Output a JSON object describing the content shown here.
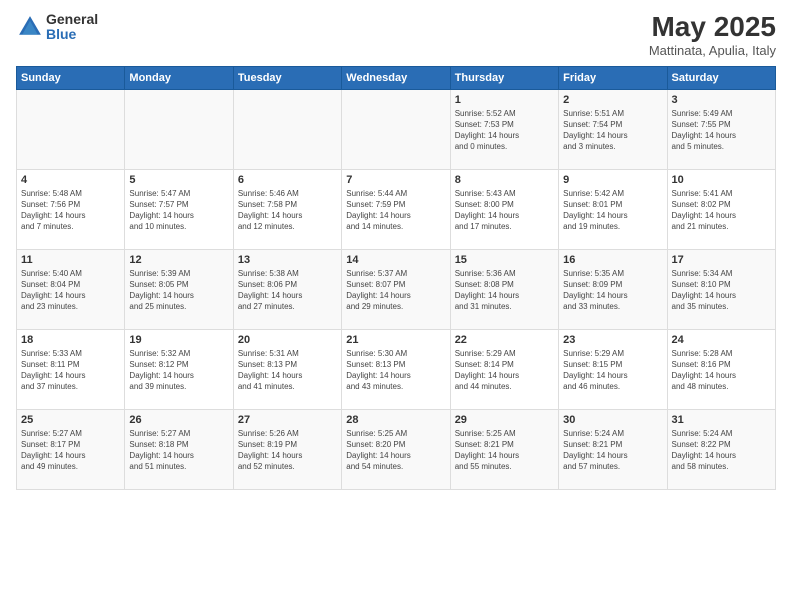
{
  "header": {
    "logo_general": "General",
    "logo_blue": "Blue",
    "month_title": "May 2025",
    "subtitle": "Mattinata, Apulia, Italy"
  },
  "days_of_week": [
    "Sunday",
    "Monday",
    "Tuesday",
    "Wednesday",
    "Thursday",
    "Friday",
    "Saturday"
  ],
  "weeks": [
    [
      {
        "day": "",
        "info": ""
      },
      {
        "day": "",
        "info": ""
      },
      {
        "day": "",
        "info": ""
      },
      {
        "day": "",
        "info": ""
      },
      {
        "day": "1",
        "info": "Sunrise: 5:52 AM\nSunset: 7:53 PM\nDaylight: 14 hours\nand 0 minutes."
      },
      {
        "day": "2",
        "info": "Sunrise: 5:51 AM\nSunset: 7:54 PM\nDaylight: 14 hours\nand 3 minutes."
      },
      {
        "day": "3",
        "info": "Sunrise: 5:49 AM\nSunset: 7:55 PM\nDaylight: 14 hours\nand 5 minutes."
      }
    ],
    [
      {
        "day": "4",
        "info": "Sunrise: 5:48 AM\nSunset: 7:56 PM\nDaylight: 14 hours\nand 7 minutes."
      },
      {
        "day": "5",
        "info": "Sunrise: 5:47 AM\nSunset: 7:57 PM\nDaylight: 14 hours\nand 10 minutes."
      },
      {
        "day": "6",
        "info": "Sunrise: 5:46 AM\nSunset: 7:58 PM\nDaylight: 14 hours\nand 12 minutes."
      },
      {
        "day": "7",
        "info": "Sunrise: 5:44 AM\nSunset: 7:59 PM\nDaylight: 14 hours\nand 14 minutes."
      },
      {
        "day": "8",
        "info": "Sunrise: 5:43 AM\nSunset: 8:00 PM\nDaylight: 14 hours\nand 17 minutes."
      },
      {
        "day": "9",
        "info": "Sunrise: 5:42 AM\nSunset: 8:01 PM\nDaylight: 14 hours\nand 19 minutes."
      },
      {
        "day": "10",
        "info": "Sunrise: 5:41 AM\nSunset: 8:02 PM\nDaylight: 14 hours\nand 21 minutes."
      }
    ],
    [
      {
        "day": "11",
        "info": "Sunrise: 5:40 AM\nSunset: 8:04 PM\nDaylight: 14 hours\nand 23 minutes."
      },
      {
        "day": "12",
        "info": "Sunrise: 5:39 AM\nSunset: 8:05 PM\nDaylight: 14 hours\nand 25 minutes."
      },
      {
        "day": "13",
        "info": "Sunrise: 5:38 AM\nSunset: 8:06 PM\nDaylight: 14 hours\nand 27 minutes."
      },
      {
        "day": "14",
        "info": "Sunrise: 5:37 AM\nSunset: 8:07 PM\nDaylight: 14 hours\nand 29 minutes."
      },
      {
        "day": "15",
        "info": "Sunrise: 5:36 AM\nSunset: 8:08 PM\nDaylight: 14 hours\nand 31 minutes."
      },
      {
        "day": "16",
        "info": "Sunrise: 5:35 AM\nSunset: 8:09 PM\nDaylight: 14 hours\nand 33 minutes."
      },
      {
        "day": "17",
        "info": "Sunrise: 5:34 AM\nSunset: 8:10 PM\nDaylight: 14 hours\nand 35 minutes."
      }
    ],
    [
      {
        "day": "18",
        "info": "Sunrise: 5:33 AM\nSunset: 8:11 PM\nDaylight: 14 hours\nand 37 minutes."
      },
      {
        "day": "19",
        "info": "Sunrise: 5:32 AM\nSunset: 8:12 PM\nDaylight: 14 hours\nand 39 minutes."
      },
      {
        "day": "20",
        "info": "Sunrise: 5:31 AM\nSunset: 8:13 PM\nDaylight: 14 hours\nand 41 minutes."
      },
      {
        "day": "21",
        "info": "Sunrise: 5:30 AM\nSunset: 8:13 PM\nDaylight: 14 hours\nand 43 minutes."
      },
      {
        "day": "22",
        "info": "Sunrise: 5:29 AM\nSunset: 8:14 PM\nDaylight: 14 hours\nand 44 minutes."
      },
      {
        "day": "23",
        "info": "Sunrise: 5:29 AM\nSunset: 8:15 PM\nDaylight: 14 hours\nand 46 minutes."
      },
      {
        "day": "24",
        "info": "Sunrise: 5:28 AM\nSunset: 8:16 PM\nDaylight: 14 hours\nand 48 minutes."
      }
    ],
    [
      {
        "day": "25",
        "info": "Sunrise: 5:27 AM\nSunset: 8:17 PM\nDaylight: 14 hours\nand 49 minutes."
      },
      {
        "day": "26",
        "info": "Sunrise: 5:27 AM\nSunset: 8:18 PM\nDaylight: 14 hours\nand 51 minutes."
      },
      {
        "day": "27",
        "info": "Sunrise: 5:26 AM\nSunset: 8:19 PM\nDaylight: 14 hours\nand 52 minutes."
      },
      {
        "day": "28",
        "info": "Sunrise: 5:25 AM\nSunset: 8:20 PM\nDaylight: 14 hours\nand 54 minutes."
      },
      {
        "day": "29",
        "info": "Sunrise: 5:25 AM\nSunset: 8:21 PM\nDaylight: 14 hours\nand 55 minutes."
      },
      {
        "day": "30",
        "info": "Sunrise: 5:24 AM\nSunset: 8:21 PM\nDaylight: 14 hours\nand 57 minutes."
      },
      {
        "day": "31",
        "info": "Sunrise: 5:24 AM\nSunset: 8:22 PM\nDaylight: 14 hours\nand 58 minutes."
      }
    ]
  ]
}
